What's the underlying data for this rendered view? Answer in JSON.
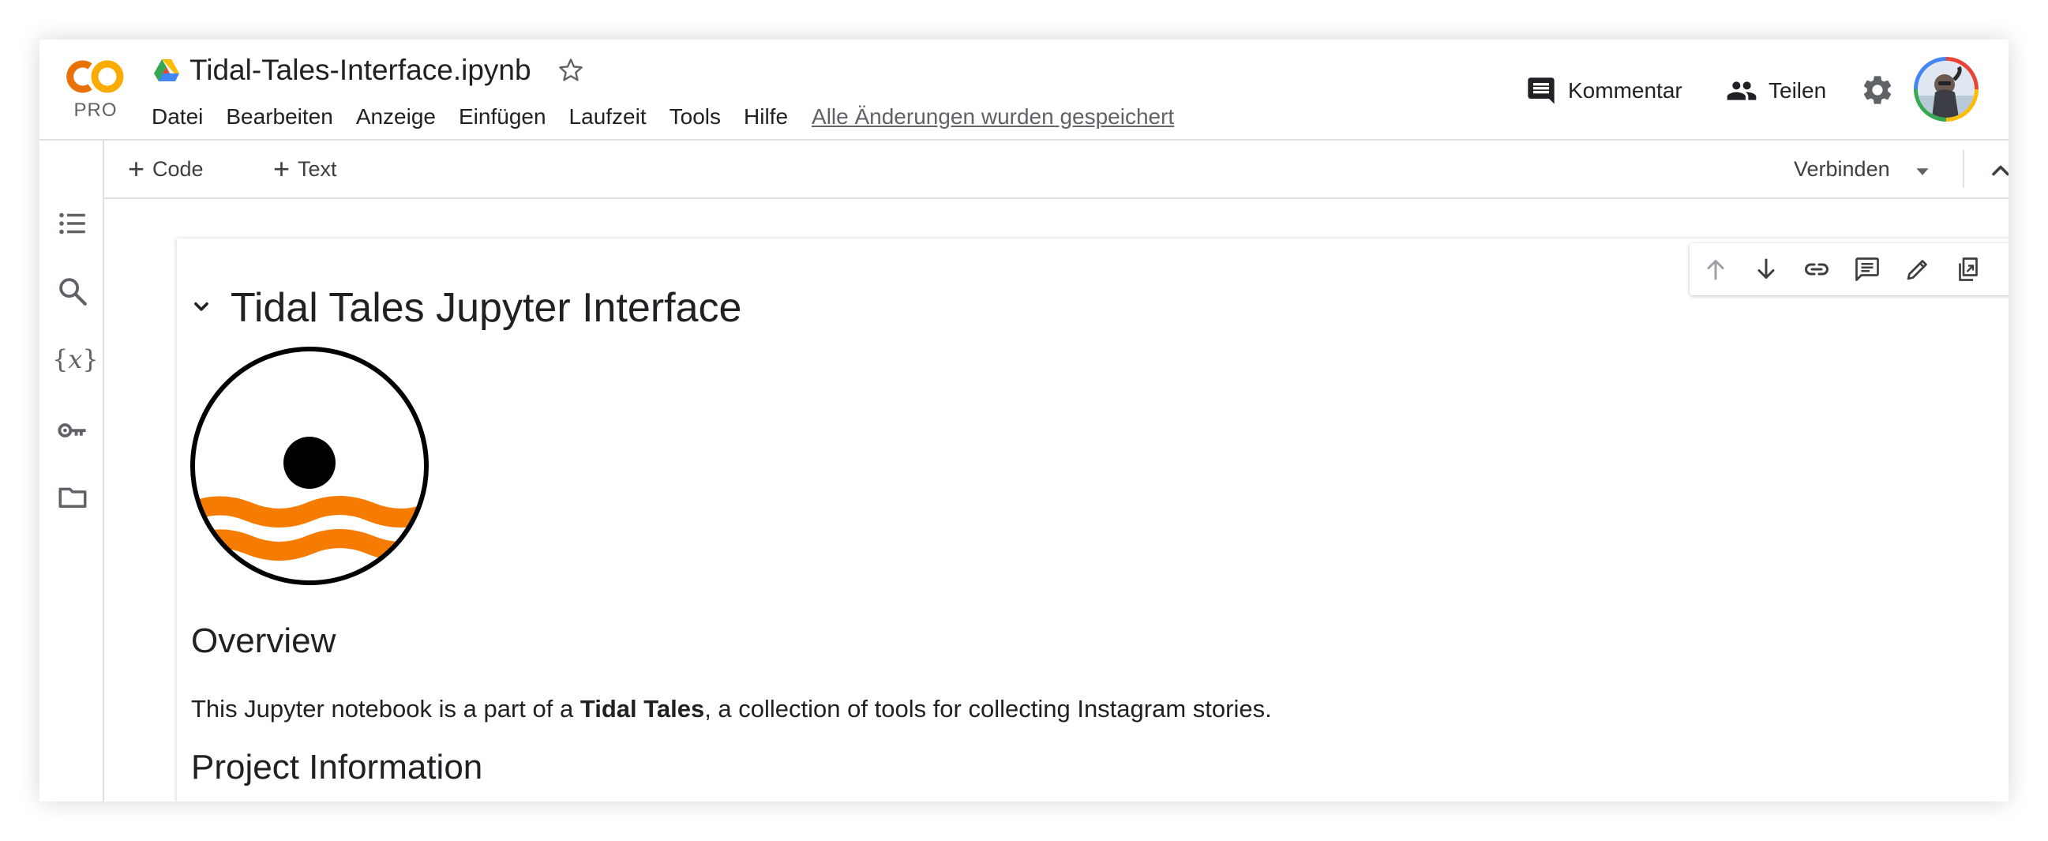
{
  "app": {
    "logo_text": "CO",
    "logo_badge": "PRO",
    "notebook_title": "Tidal-Tales-Interface.ipynb",
    "save_status": "Alle Änderungen wurden gespeichert"
  },
  "menu": [
    "Datei",
    "Bearbeiten",
    "Anzeige",
    "Einfügen",
    "Laufzeit",
    "Tools",
    "Hilfe"
  ],
  "header_actions": {
    "comment_label": "Kommentar",
    "share_label": "Teilen"
  },
  "sidebar": {
    "items": [
      {
        "icon": "table-of-contents-icon"
      },
      {
        "icon": "search-icon"
      },
      {
        "icon": "variables-icon",
        "glyph_left": "{",
        "glyph_var": "x",
        "glyph_right": "}"
      },
      {
        "icon": "secrets-key-icon"
      },
      {
        "icon": "files-folder-icon"
      }
    ]
  },
  "toolbar": {
    "add_code_label": "Code",
    "add_text_label": "Text",
    "connect_label": "Verbinden"
  },
  "cell_toolbar": {
    "icons": [
      "move-up-icon",
      "move-down-icon",
      "link-icon",
      "comment-icon",
      "edit-icon",
      "copy-to-scratch-icon",
      "delete-icon",
      "more-options-icon"
    ]
  },
  "cell": {
    "heading": "Tidal Tales Jupyter Interface",
    "overview_heading": "Overview",
    "paragraph_before": "This Jupyter notebook is a part of a ",
    "paragraph_bold": "Tidal Tales",
    "paragraph_after": ", a collection of tools for collecting Instagram stories.",
    "project_heading": "Project Information"
  },
  "colors": {
    "colab_orange": "#f9ab00",
    "colab_orange_dark": "#e8710a",
    "wave_orange": "#f57c00",
    "text": "#202124",
    "icon_gray": "#5f6368",
    "border": "#e0e0e0"
  }
}
